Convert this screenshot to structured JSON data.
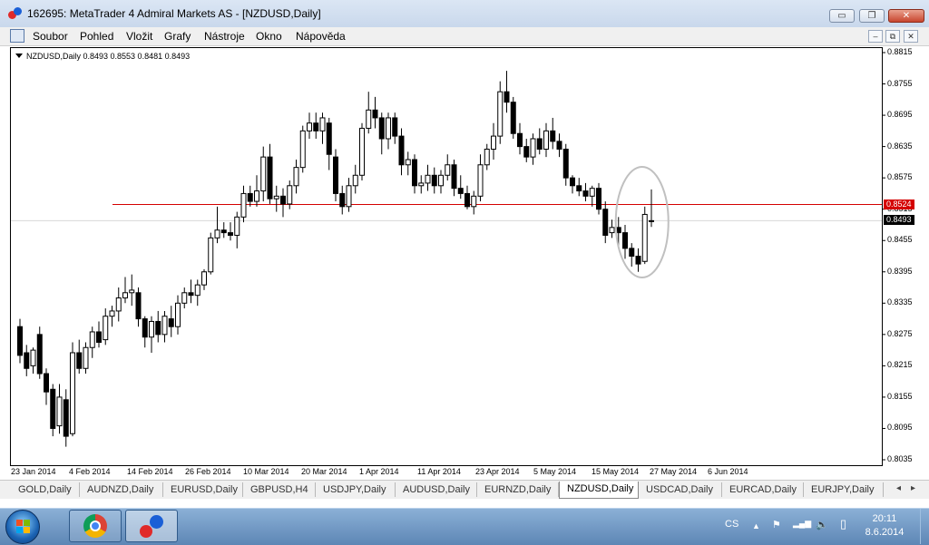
{
  "window": {
    "title": "162695: MetaTrader 4 Admiral Markets AS - [NZDUSD,Daily]",
    "minimize_symbol": "▭",
    "restore_symbol": "❐",
    "close_symbol": "✕"
  },
  "menu": {
    "items": [
      "Soubor",
      "Pohled",
      "Vložit",
      "Grafy",
      "Nástroje",
      "Okno",
      "Nápověda"
    ],
    "mdi_minimize": "‒",
    "mdi_restore": "⧉",
    "mdi_close": "✕"
  },
  "chart_info": "NZDUSD,Daily  0.8493 0.8553 0.8481 0.8493",
  "price_boxes": {
    "line_price": "0.8524",
    "bid_price": "0.8493"
  },
  "tabs": [
    "GOLD,Daily",
    "AUDNZD,Daily",
    "EURUSD,Daily",
    "GBPUSD,H4",
    "USDJPY,Daily",
    "AUDUSD,Daily",
    "EURNZD,Daily",
    "NZDUSD,Daily",
    "USDCAD,Daily",
    "EURCAD,Daily",
    "EURJPY,Daily"
  ],
  "active_tab": "NZDUSD,Daily",
  "tab_scroll": {
    "left": "◂",
    "right": "▸"
  },
  "taskbar": {
    "language": "CS",
    "tray_up": "▲",
    "flag_icon": "⚑",
    "signal_icon": "▂▄▆",
    "speaker_icon": "🔈",
    "battery_icon": "▯",
    "time": "20:11",
    "date": "8.6.2014"
  },
  "colors": {
    "horizontal_line": "#d40000",
    "bid_box": "#000000",
    "line_box": "#d40000",
    "ellipse": "#c0c0c0"
  },
  "chart_data": {
    "type": "candlestick",
    "symbol": "NZDUSD",
    "timeframe": "Daily",
    "yticks": [
      "0.8815",
      "0.8755",
      "0.8695",
      "0.8635",
      "0.8575",
      "0.8515",
      "0.8455",
      "0.8395",
      "0.8335",
      "0.8275",
      "0.8215",
      "0.8155",
      "0.8095",
      "0.8035"
    ],
    "ylim": [
      0.8025,
      0.8825
    ],
    "xticks": [
      "23 Jan 2014",
      "4 Feb 2014",
      "14 Feb 2014",
      "26 Feb 2014",
      "10 Mar 2014",
      "20 Mar 2014",
      "1 Apr 2014",
      "11 Apr 2014",
      "23 Apr 2014",
      "5 May 2014",
      "15 May 2014",
      "27 May 2014",
      "6 Jun 2014"
    ],
    "horizontal_line": 0.8524,
    "close": 0.8493,
    "highlight_ellipse": "around last days",
    "candles": [
      [
        0.829,
        0.8305,
        0.822,
        0.8235
      ],
      [
        0.824,
        0.8255,
        0.8195,
        0.821
      ],
      [
        0.8215,
        0.825,
        0.82,
        0.8245
      ],
      [
        0.8275,
        0.829,
        0.819,
        0.82
      ],
      [
        0.82,
        0.821,
        0.814,
        0.8165
      ],
      [
        0.817,
        0.818,
        0.808,
        0.8095
      ],
      [
        0.81,
        0.818,
        0.8085,
        0.8155
      ],
      [
        0.815,
        0.817,
        0.806,
        0.808
      ],
      [
        0.8085,
        0.826,
        0.808,
        0.824
      ],
      [
        0.824,
        0.8265,
        0.82,
        0.821
      ],
      [
        0.821,
        0.826,
        0.82,
        0.825
      ],
      [
        0.825,
        0.829,
        0.823,
        0.828
      ],
      [
        0.828,
        0.83,
        0.825,
        0.826
      ],
      [
        0.8265,
        0.8325,
        0.8255,
        0.831
      ],
      [
        0.831,
        0.833,
        0.829,
        0.832
      ],
      [
        0.832,
        0.8365,
        0.83,
        0.8345
      ],
      [
        0.8345,
        0.8385,
        0.8335,
        0.8355
      ],
      [
        0.8355,
        0.839,
        0.833,
        0.836
      ],
      [
        0.8355,
        0.8365,
        0.829,
        0.8305
      ],
      [
        0.8305,
        0.831,
        0.825,
        0.827
      ],
      [
        0.827,
        0.831,
        0.824,
        0.83
      ],
      [
        0.83,
        0.832,
        0.826,
        0.8275
      ],
      [
        0.8275,
        0.832,
        0.826,
        0.831
      ],
      [
        0.8305,
        0.833,
        0.827,
        0.829
      ],
      [
        0.829,
        0.835,
        0.8275,
        0.8335
      ],
      [
        0.8335,
        0.8365,
        0.8325,
        0.8355
      ],
      [
        0.8355,
        0.838,
        0.8335,
        0.835
      ],
      [
        0.835,
        0.838,
        0.833,
        0.837
      ],
      [
        0.837,
        0.84,
        0.836,
        0.8395
      ],
      [
        0.8395,
        0.847,
        0.839,
        0.846
      ],
      [
        0.846,
        0.852,
        0.845,
        0.8475
      ],
      [
        0.8475,
        0.849,
        0.846,
        0.847
      ],
      [
        0.847,
        0.849,
        0.8455,
        0.8465
      ],
      [
        0.8465,
        0.851,
        0.844,
        0.85
      ],
      [
        0.85,
        0.856,
        0.849,
        0.8545
      ],
      [
        0.8545,
        0.856,
        0.852,
        0.853
      ],
      [
        0.853,
        0.858,
        0.852,
        0.855
      ],
      [
        0.855,
        0.8635,
        0.853,
        0.8615
      ],
      [
        0.8615,
        0.864,
        0.8525,
        0.8535
      ],
      [
        0.8535,
        0.856,
        0.851,
        0.854
      ],
      [
        0.854,
        0.8555,
        0.85,
        0.8525
      ],
      [
        0.8525,
        0.857,
        0.8515,
        0.856
      ],
      [
        0.856,
        0.861,
        0.8545,
        0.8595
      ],
      [
        0.8595,
        0.8675,
        0.8585,
        0.8665
      ],
      [
        0.8665,
        0.87,
        0.865,
        0.868
      ],
      [
        0.868,
        0.87,
        0.865,
        0.8665
      ],
      [
        0.8665,
        0.87,
        0.864,
        0.869
      ],
      [
        0.868,
        0.869,
        0.859,
        0.862
      ],
      [
        0.8615,
        0.863,
        0.853,
        0.8545
      ],
      [
        0.8545,
        0.856,
        0.8505,
        0.852
      ],
      [
        0.852,
        0.8575,
        0.851,
        0.856
      ],
      [
        0.856,
        0.86,
        0.8545,
        0.858
      ],
      [
        0.858,
        0.868,
        0.857,
        0.867
      ],
      [
        0.867,
        0.874,
        0.866,
        0.8705
      ],
      [
        0.8705,
        0.873,
        0.867,
        0.869
      ],
      [
        0.869,
        0.87,
        0.862,
        0.865
      ],
      [
        0.865,
        0.87,
        0.863,
        0.869
      ],
      [
        0.869,
        0.87,
        0.864,
        0.8655
      ],
      [
        0.8655,
        0.867,
        0.858,
        0.86
      ],
      [
        0.86,
        0.8625,
        0.858,
        0.861
      ],
      [
        0.861,
        0.862,
        0.8545,
        0.856
      ],
      [
        0.856,
        0.858,
        0.8545,
        0.8565
      ],
      [
        0.8565,
        0.86,
        0.855,
        0.858
      ],
      [
        0.858,
        0.8595,
        0.8545,
        0.856
      ],
      [
        0.856,
        0.859,
        0.8545,
        0.858
      ],
      [
        0.858,
        0.862,
        0.857,
        0.86
      ],
      [
        0.86,
        0.861,
        0.854,
        0.8555
      ],
      [
        0.8555,
        0.858,
        0.8535,
        0.8545
      ],
      [
        0.8545,
        0.856,
        0.8515,
        0.852
      ],
      [
        0.852,
        0.855,
        0.8505,
        0.854
      ],
      [
        0.854,
        0.862,
        0.853,
        0.86
      ],
      [
        0.86,
        0.864,
        0.859,
        0.863
      ],
      [
        0.863,
        0.868,
        0.861,
        0.8655
      ],
      [
        0.8655,
        0.876,
        0.864,
        0.874
      ],
      [
        0.874,
        0.878,
        0.87,
        0.872
      ],
      [
        0.872,
        0.873,
        0.865,
        0.866
      ],
      [
        0.866,
        0.868,
        0.862,
        0.8635
      ],
      [
        0.8635,
        0.865,
        0.8605,
        0.8615
      ],
      [
        0.8615,
        0.866,
        0.86,
        0.865
      ],
      [
        0.865,
        0.867,
        0.862,
        0.863
      ],
      [
        0.863,
        0.868,
        0.8615,
        0.8665
      ],
      [
        0.8665,
        0.869,
        0.863,
        0.8645
      ],
      [
        0.8645,
        0.866,
        0.8615,
        0.863
      ],
      [
        0.863,
        0.864,
        0.856,
        0.8575
      ],
      [
        0.8575,
        0.858,
        0.8545,
        0.856
      ],
      [
        0.856,
        0.8575,
        0.854,
        0.855
      ],
      [
        0.855,
        0.8565,
        0.853,
        0.854
      ],
      [
        0.854,
        0.856,
        0.852,
        0.8555
      ],
      [
        0.8555,
        0.8565,
        0.8505,
        0.8515
      ],
      [
        0.8515,
        0.853,
        0.845,
        0.8465
      ],
      [
        0.847,
        0.8495,
        0.846,
        0.848
      ],
      [
        0.848,
        0.85,
        0.844,
        0.847
      ],
      [
        0.847,
        0.8485,
        0.842,
        0.844
      ],
      [
        0.844,
        0.845,
        0.8405,
        0.8425
      ],
      [
        0.8425,
        0.844,
        0.8395,
        0.841
      ],
      [
        0.8415,
        0.852,
        0.841,
        0.8505
      ],
      [
        0.8493,
        0.8553,
        0.8481,
        0.8493
      ]
    ]
  }
}
